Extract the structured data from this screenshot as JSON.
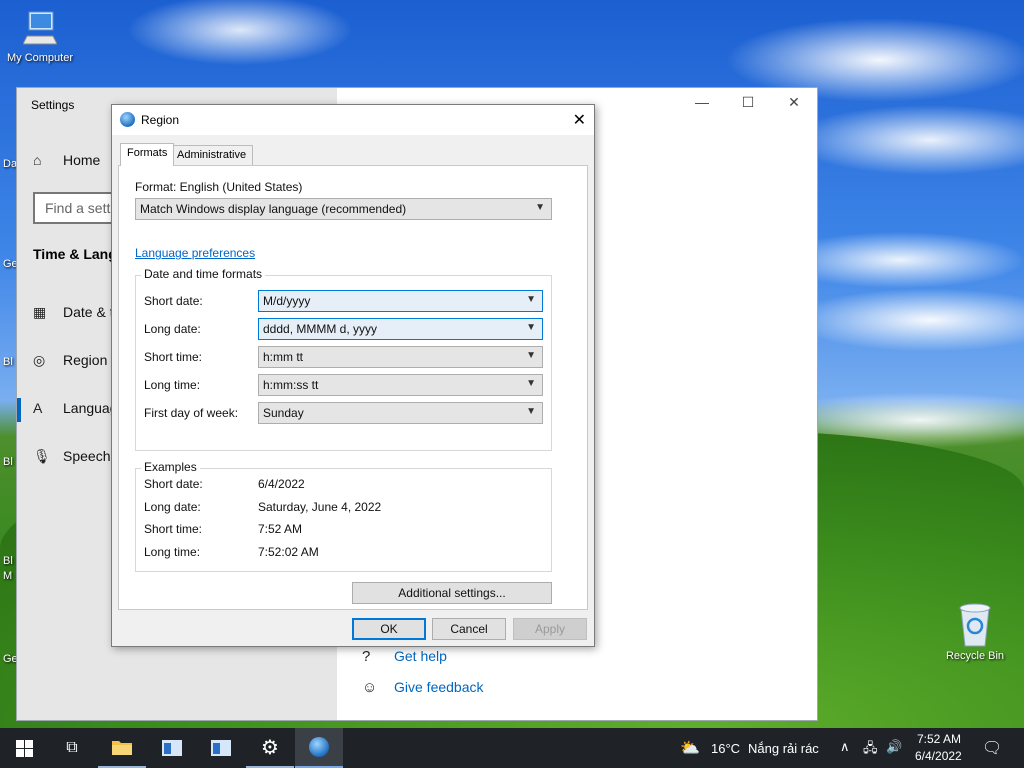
{
  "desktop": {
    "icons": [
      {
        "label": "My Computer"
      },
      {
        "label": "Recycle Bin"
      }
    ],
    "partial_labels": [
      "Da",
      "Ge",
      "Bl",
      "Bl",
      "Bl",
      "M",
      "Ge"
    ]
  },
  "settings": {
    "title": "Settings",
    "nav_home": "Home",
    "search_placeholder": "Find a setti",
    "section_heading": "Time & Lang",
    "nav_items": [
      "Date & t",
      "Region",
      "Languag",
      "Speech"
    ],
    "links": {
      "help": "Get help",
      "feedback": "Give feedback"
    }
  },
  "dialog": {
    "title": "Region",
    "tabs": [
      "Formats",
      "Administrative"
    ],
    "format_label": "Format: English (United States)",
    "format_value": "Match Windows display language (recommended)",
    "language_prefs_link": "Language preferences",
    "datetime_group": "Date and time formats",
    "fields": [
      {
        "label": "Short date:",
        "value": "M/d/yyyy"
      },
      {
        "label": "Long date:",
        "value": "dddd, MMMM d, yyyy"
      },
      {
        "label": "Short time:",
        "value": "h:mm tt"
      },
      {
        "label": "Long time:",
        "value": "h:mm:ss tt"
      },
      {
        "label": "First day of week:",
        "value": "Sunday"
      }
    ],
    "examples_group": "Examples",
    "examples": [
      {
        "label": "Short date:",
        "value": "6/4/2022"
      },
      {
        "label": "Long date:",
        "value": "Saturday, June 4, 2022"
      },
      {
        "label": "Short time:",
        "value": "7:52 AM"
      },
      {
        "label": "Long time:",
        "value": "7:52:02 AM"
      }
    ],
    "additional_settings": "Additional settings...",
    "ok": "OK",
    "cancel": "Cancel",
    "apply": "Apply"
  },
  "taskbar": {
    "weather_temp": "16°C",
    "weather_text": "Nắng rải rác",
    "time": "7:52 AM",
    "date": "6/4/2022"
  }
}
